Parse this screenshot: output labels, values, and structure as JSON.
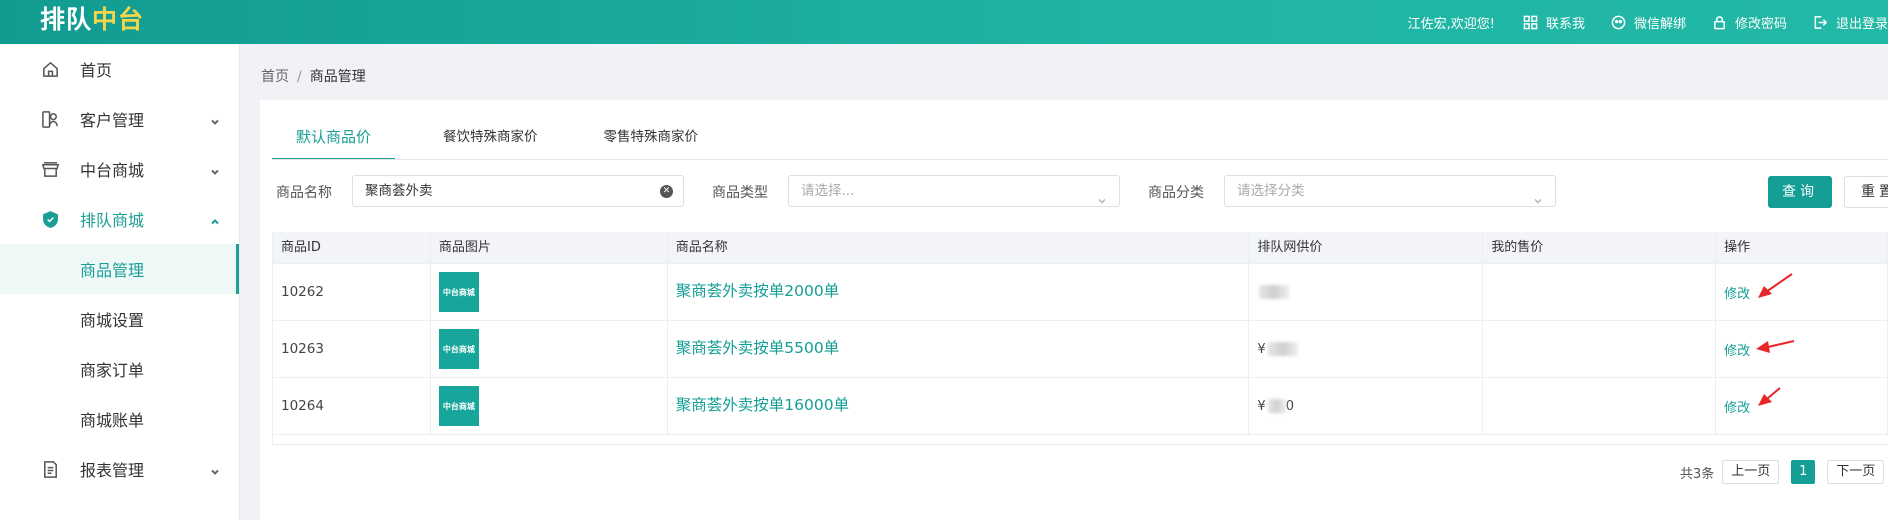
{
  "header": {
    "logo_pre": "排队",
    "logo_accent": "中台",
    "greeting": "江佐宏,欢迎您!",
    "items": [
      {
        "label": "联系我",
        "icon": "grid-icon"
      },
      {
        "label": "微信解绑",
        "icon": "wechat-icon"
      },
      {
        "label": "修改密码",
        "icon": "lock-icon"
      },
      {
        "label": "退出登录",
        "icon": "logout-icon"
      }
    ]
  },
  "sidebar": {
    "items": [
      {
        "label": "首页",
        "icon": "home-icon"
      },
      {
        "label": "客户管理",
        "icon": "users-icon"
      },
      {
        "label": "中台商城",
        "icon": "store-icon"
      },
      {
        "label": "排队商城",
        "icon": "shield-icon"
      },
      {
        "label": "报表管理",
        "icon": "report-icon"
      }
    ],
    "sub_items": [
      {
        "label": "商品管理"
      },
      {
        "label": "商城设置"
      },
      {
        "label": "商家订单"
      },
      {
        "label": "商城账单"
      }
    ]
  },
  "breadcrumb": {
    "home": "首页",
    "sep": "/",
    "current": "商品管理"
  },
  "tabs": [
    {
      "label": "默认商品价"
    },
    {
      "label": "餐饮特殊商家价"
    },
    {
      "label": "零售特殊商家价"
    }
  ],
  "filters": {
    "name_label": "商品名称",
    "name_value": "聚商荟外卖",
    "type_label": "商品类型",
    "type_placeholder": "请选择...",
    "category_label": "商品分类",
    "category_placeholder": "请选择分类",
    "query_button": "查询",
    "reset_button": "重置"
  },
  "table": {
    "headers": [
      "商品ID",
      "商品图片",
      "商品名称",
      "排队网供价",
      "我的售价",
      "操作"
    ],
    "rows": [
      {
        "id": "10262",
        "thumb": "中台商城",
        "name": "聚商荟外卖按单2000单",
        "price": "",
        "my_price": "",
        "action": "修改"
      },
      {
        "id": "10263",
        "thumb": "中台商城",
        "name": "聚商荟外卖按单5500单",
        "price": "¥",
        "my_price": "",
        "action": "修改"
      },
      {
        "id": "10264",
        "thumb": "中台商城",
        "name": "聚商荟外卖按单16000单",
        "price": "¥",
        "price_tail": "0",
        "my_price": "",
        "action": "修改"
      }
    ]
  },
  "pagination": {
    "total": "共3条",
    "prev": "上一页",
    "current": "1",
    "next": "下一页"
  },
  "colors": {
    "primary": "#149e96",
    "annotation_arrow": "#e8262a",
    "logo_accent": "#f5d64a"
  }
}
